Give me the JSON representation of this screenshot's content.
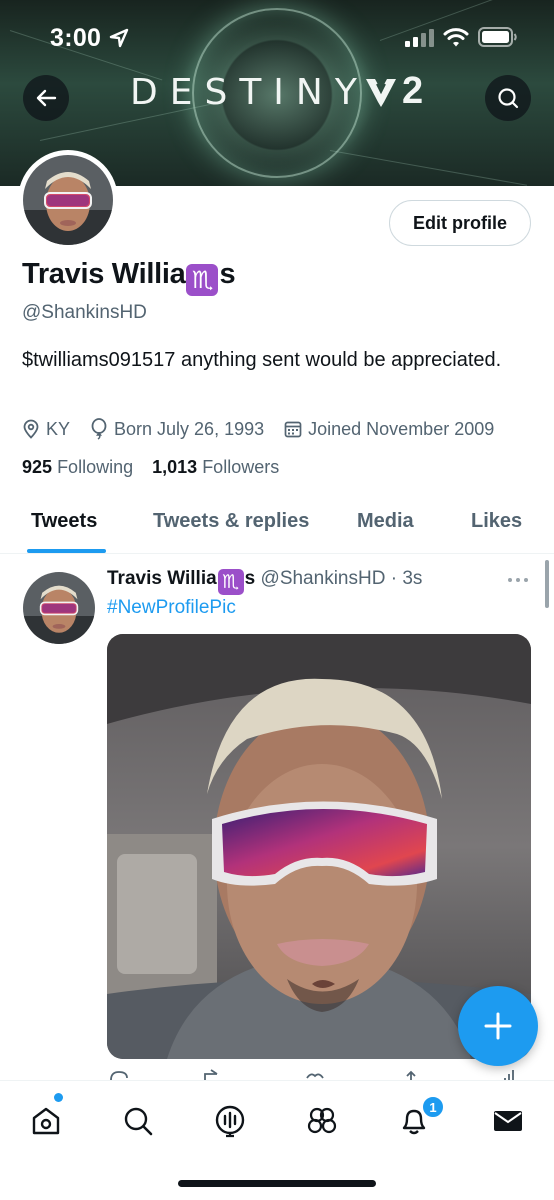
{
  "status_bar": {
    "time": "3:00"
  },
  "banner": {
    "title": "DESTINY",
    "number": "2"
  },
  "profile": {
    "edit_button": "Edit profile",
    "name_start": "Travis Willia",
    "name_emoji": "♏",
    "name_end": "s",
    "handle": "@ShankinsHD",
    "bio": "$twilliams091517 anything sent would be appreciated.",
    "location": "KY",
    "birthday": "Born July 26, 1993",
    "joined": "Joined November 2009",
    "following_count": "925",
    "following_label": "Following",
    "followers_count": "1,013",
    "followers_label": "Followers"
  },
  "tabs": [
    {
      "label": "Tweets",
      "active": true
    },
    {
      "label": "Tweets & replies",
      "active": false
    },
    {
      "label": "Media",
      "active": false
    },
    {
      "label": "Likes",
      "active": false
    }
  ],
  "tweet": {
    "name_start": "Travis Willia",
    "name_emoji": "♏",
    "name_end": "s",
    "handle": "@ShankinsHD",
    "separator": "·",
    "time": "3s",
    "text": "#NewProfilePic"
  },
  "bottom_nav": {
    "items": [
      "home-icon",
      "search-icon",
      "spaces-icon",
      "communities-icon",
      "notifications-icon",
      "messages-icon"
    ],
    "notification_count": "1"
  },
  "colors": {
    "accent": "#1d9bf0",
    "text": "#0f1419",
    "secondary": "#536471",
    "zodiac": "#9b4fc9"
  }
}
